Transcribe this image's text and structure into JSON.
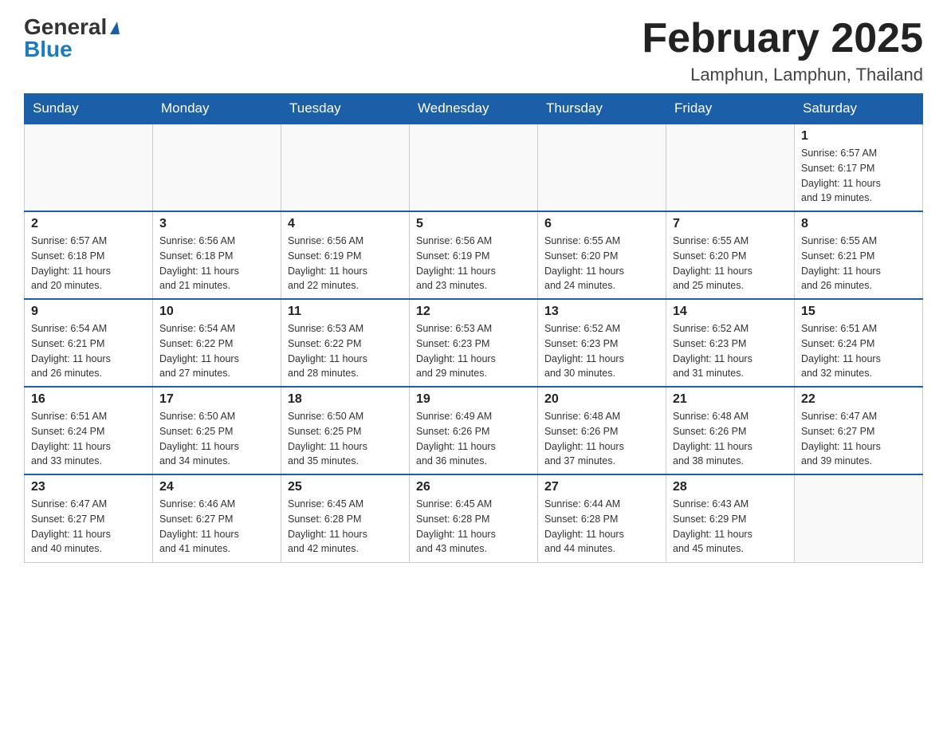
{
  "logo": {
    "general": "General",
    "blue": "Blue",
    "triangle": "▲"
  },
  "header": {
    "month_title": "February 2025",
    "location": "Lamphun, Lamphun, Thailand"
  },
  "weekdays": [
    "Sunday",
    "Monday",
    "Tuesday",
    "Wednesday",
    "Thursday",
    "Friday",
    "Saturday"
  ],
  "weeks": [
    [
      {
        "day": "",
        "info": ""
      },
      {
        "day": "",
        "info": ""
      },
      {
        "day": "",
        "info": ""
      },
      {
        "day": "",
        "info": ""
      },
      {
        "day": "",
        "info": ""
      },
      {
        "day": "",
        "info": ""
      },
      {
        "day": "1",
        "info": "Sunrise: 6:57 AM\nSunset: 6:17 PM\nDaylight: 11 hours\nand 19 minutes."
      }
    ],
    [
      {
        "day": "2",
        "info": "Sunrise: 6:57 AM\nSunset: 6:18 PM\nDaylight: 11 hours\nand 20 minutes."
      },
      {
        "day": "3",
        "info": "Sunrise: 6:56 AM\nSunset: 6:18 PM\nDaylight: 11 hours\nand 21 minutes."
      },
      {
        "day": "4",
        "info": "Sunrise: 6:56 AM\nSunset: 6:19 PM\nDaylight: 11 hours\nand 22 minutes."
      },
      {
        "day": "5",
        "info": "Sunrise: 6:56 AM\nSunset: 6:19 PM\nDaylight: 11 hours\nand 23 minutes."
      },
      {
        "day": "6",
        "info": "Sunrise: 6:55 AM\nSunset: 6:20 PM\nDaylight: 11 hours\nand 24 minutes."
      },
      {
        "day": "7",
        "info": "Sunrise: 6:55 AM\nSunset: 6:20 PM\nDaylight: 11 hours\nand 25 minutes."
      },
      {
        "day": "8",
        "info": "Sunrise: 6:55 AM\nSunset: 6:21 PM\nDaylight: 11 hours\nand 26 minutes."
      }
    ],
    [
      {
        "day": "9",
        "info": "Sunrise: 6:54 AM\nSunset: 6:21 PM\nDaylight: 11 hours\nand 26 minutes."
      },
      {
        "day": "10",
        "info": "Sunrise: 6:54 AM\nSunset: 6:22 PM\nDaylight: 11 hours\nand 27 minutes."
      },
      {
        "day": "11",
        "info": "Sunrise: 6:53 AM\nSunset: 6:22 PM\nDaylight: 11 hours\nand 28 minutes."
      },
      {
        "day": "12",
        "info": "Sunrise: 6:53 AM\nSunset: 6:23 PM\nDaylight: 11 hours\nand 29 minutes."
      },
      {
        "day": "13",
        "info": "Sunrise: 6:52 AM\nSunset: 6:23 PM\nDaylight: 11 hours\nand 30 minutes."
      },
      {
        "day": "14",
        "info": "Sunrise: 6:52 AM\nSunset: 6:23 PM\nDaylight: 11 hours\nand 31 minutes."
      },
      {
        "day": "15",
        "info": "Sunrise: 6:51 AM\nSunset: 6:24 PM\nDaylight: 11 hours\nand 32 minutes."
      }
    ],
    [
      {
        "day": "16",
        "info": "Sunrise: 6:51 AM\nSunset: 6:24 PM\nDaylight: 11 hours\nand 33 minutes."
      },
      {
        "day": "17",
        "info": "Sunrise: 6:50 AM\nSunset: 6:25 PM\nDaylight: 11 hours\nand 34 minutes."
      },
      {
        "day": "18",
        "info": "Sunrise: 6:50 AM\nSunset: 6:25 PM\nDaylight: 11 hours\nand 35 minutes."
      },
      {
        "day": "19",
        "info": "Sunrise: 6:49 AM\nSunset: 6:26 PM\nDaylight: 11 hours\nand 36 minutes."
      },
      {
        "day": "20",
        "info": "Sunrise: 6:48 AM\nSunset: 6:26 PM\nDaylight: 11 hours\nand 37 minutes."
      },
      {
        "day": "21",
        "info": "Sunrise: 6:48 AM\nSunset: 6:26 PM\nDaylight: 11 hours\nand 38 minutes."
      },
      {
        "day": "22",
        "info": "Sunrise: 6:47 AM\nSunset: 6:27 PM\nDaylight: 11 hours\nand 39 minutes."
      }
    ],
    [
      {
        "day": "23",
        "info": "Sunrise: 6:47 AM\nSunset: 6:27 PM\nDaylight: 11 hours\nand 40 minutes."
      },
      {
        "day": "24",
        "info": "Sunrise: 6:46 AM\nSunset: 6:27 PM\nDaylight: 11 hours\nand 41 minutes."
      },
      {
        "day": "25",
        "info": "Sunrise: 6:45 AM\nSunset: 6:28 PM\nDaylight: 11 hours\nand 42 minutes."
      },
      {
        "day": "26",
        "info": "Sunrise: 6:45 AM\nSunset: 6:28 PM\nDaylight: 11 hours\nand 43 minutes."
      },
      {
        "day": "27",
        "info": "Sunrise: 6:44 AM\nSunset: 6:28 PM\nDaylight: 11 hours\nand 44 minutes."
      },
      {
        "day": "28",
        "info": "Sunrise: 6:43 AM\nSunset: 6:29 PM\nDaylight: 11 hours\nand 45 minutes."
      },
      {
        "day": "",
        "info": ""
      }
    ]
  ]
}
